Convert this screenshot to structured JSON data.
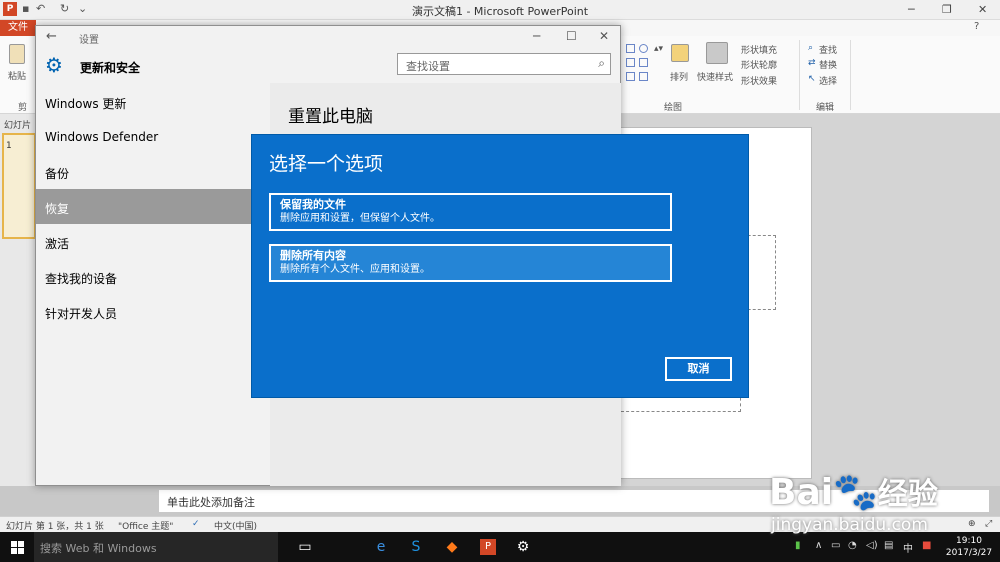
{
  "powerpoint": {
    "window_title": "演示文稿1 - Microsoft PowerPoint",
    "file_tab": "文件",
    "help": "?",
    "ribbon": {
      "paste": "粘贴",
      "clipboard": "剪",
      "arrange": "排列",
      "quick_styles": "快速样式",
      "shape_fill": "形状填充",
      "shape_outline": "形状轮廓",
      "shape_effects": "形状效果",
      "drawing_group": "绘图",
      "find": "查找",
      "replace": "替换",
      "select": "选择",
      "editing_group": "编辑"
    },
    "slides_pane_label": "幻灯片",
    "slide_number": "1",
    "notes_placeholder": "单击此处添加备注",
    "status": {
      "slide_info": "幻灯片 第 1 张，共 1 张",
      "theme": "\"Office 主题\"",
      "language": "中文(中国)"
    }
  },
  "settings": {
    "title": "设置",
    "header_title": "更新和安全",
    "search_placeholder": "查找设置",
    "nav": [
      {
        "label": "Windows 更新"
      },
      {
        "label": "Windows Defender"
      },
      {
        "label": "备份"
      },
      {
        "label": "恢复"
      },
      {
        "label": "激活"
      },
      {
        "label": "查找我的设备"
      },
      {
        "label": "针对开发人员"
      }
    ],
    "content_title": "重置此电脑"
  },
  "dialog": {
    "title": "选择一个选项",
    "options": [
      {
        "title": "保留我的文件",
        "description": "删除应用和设置，但保留个人文件。"
      },
      {
        "title": "删除所有内容",
        "description": "删除所有个人文件、应用和设置。"
      }
    ],
    "cancel_label": "取消"
  },
  "taskbar": {
    "search_placeholder": "搜索 Web 和 Windows",
    "ime": "中",
    "time": "19:10",
    "date": "2017/3/27"
  },
  "watermark": {
    "brand_latin": "Bai",
    "brand_cn": "经验",
    "url": "jingyan.baidu.com"
  },
  "colors": {
    "dialog_bg": "#0a6fcb",
    "option_highlight": "#2585d6",
    "settings_accent": "#0063b1",
    "powerpoint_accent": "#d24726",
    "nav_selected": "#9a9a9a",
    "taskbar": "#101010"
  }
}
